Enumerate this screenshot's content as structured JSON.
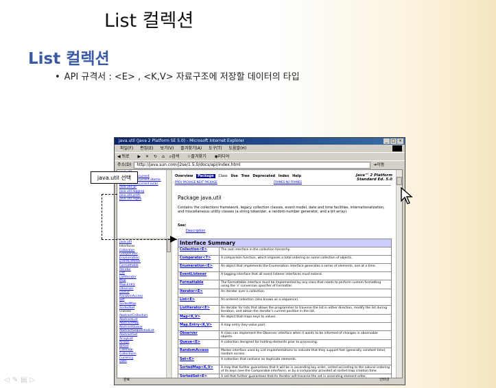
{
  "slide": {
    "title": "List 컬렉션",
    "heading": "List 컬렉션",
    "bullet": "API 규격서 : <E> , <K,V>  자료구조에 저장할 데이터의 타입"
  },
  "browser": {
    "window_title": "java.util (Java 2 Platform SE 5.0) - Microsoft Internet Explorer",
    "menu": [
      "파일(F)",
      "편집(E)",
      "보기(V)",
      "즐겨찾기(A)",
      "도구(T)",
      "도움말(H)"
    ],
    "toolbar": [
      "뒤로",
      "검색",
      "즐겨찾기",
      "미디어"
    ],
    "address_label": "주소(D)",
    "address_url": "http://java.sun.com/j2se/1.5.0/docs/api/index.html",
    "go_label": "이동",
    "status_left": "완료",
    "status_right": "인터넷"
  },
  "left_frame": {
    "packages": [
      "java.util",
      "java.util.concurrent",
      "java.util.concurrent.atomic",
      "java.util.concurrent.locks",
      "java.util.jar",
      "java.util.logging",
      "java.util.prefs",
      "java.util.regex"
    ],
    "current_package": "java.util",
    "interfaces_label": "Interfaces",
    "interfaces": [
      "Collection",
      "Comparator",
      "Enumeration",
      "EventListener",
      "Formattable",
      "Iterator",
      "List",
      "ListIterator",
      "Map",
      "Map.Entry",
      "Observer",
      "Queue",
      "RandomAccess",
      "Set",
      "SortedMap",
      "SortedSet"
    ],
    "classes_label": "Classes",
    "classes": [
      "AbstractCollection",
      "AbstractList",
      "AbstractMap",
      "AbstractQueue",
      "AbstractSequentialList",
      "AbstractSet",
      "ArrayList",
      "Arrays",
      "BitSet",
      "Calendar",
      "Collections",
      "Currency",
      "Date"
    ]
  },
  "doc": {
    "nav": [
      "Overview",
      "Package",
      "Class",
      "Use",
      "Tree",
      "Deprecated",
      "Index",
      "Help"
    ],
    "nav_active": "Package",
    "prev_next": "PREV PACKAGE   NEXT PACKAGE",
    "frames": "FRAMES   NO FRAMES",
    "platform_line1": "Java™ 2 Platform",
    "platform_line2": "Standard Ed. 5.0",
    "package_title": "Package java.util",
    "package_desc": "Contains the collections framework, legacy collection classes, event model, date and time facilities, internationalization, and miscellaneous utility classes (a string tokenizer, a random-number generator, and a bit array).",
    "see_label": "See:",
    "description_link": "Description",
    "table_title": "Interface Summary",
    "interfaces": [
      {
        "name": "Collection<E>",
        "desc": "The root interface in the collection hierarchy."
      },
      {
        "name": "Comparator<T>",
        "desc": "A comparison function, which imposes a total ordering on some collection of objects."
      },
      {
        "name": "Enumeration<E>",
        "desc": "An object that implements the Enumeration interface generates a series of elements, one at a time."
      },
      {
        "name": "EventListener",
        "desc": "A tagging interface that all event listener interfaces must extend."
      },
      {
        "name": "Formattable",
        "desc": "The Formattable interface must be implemented by any class that needs to perform custom formatting using the 's' conversion specifier of Formatter."
      },
      {
        "name": "Iterator<E>",
        "desc": "An iterator over a collection."
      },
      {
        "name": "List<E>",
        "desc": "An ordered collection (also known as a sequence)."
      },
      {
        "name": "ListIterator<E>",
        "desc": "An iterator for lists that allows the programmer to traverse the list in either direction, modify the list during iteration, and obtain the iterator's current position in the list."
      },
      {
        "name": "Map<K,V>",
        "desc": "An object that maps keys to values."
      },
      {
        "name": "Map.Entry<K,V>",
        "desc": "A map entry (key-value pair)."
      },
      {
        "name": "Observer",
        "desc": "A class can implement the Observer interface when it wants to be informed of changes in observable objects."
      },
      {
        "name": "Queue<E>",
        "desc": "A collection designed for holding elements prior to processing."
      },
      {
        "name": "RandomAccess",
        "desc": "Marker interface used by List implementations to indicate that they support fast (generally constant time) random access."
      },
      {
        "name": "Set<E>",
        "desc": "A collection that contains no duplicate elements."
      },
      {
        "name": "SortedMap<K,V>",
        "desc": "A map that further guarantees that it will be in ascending key order, sorted according to the natural ordering of its keys (see the Comparable interface), or by a comparator provided at sorted map creation time."
      },
      {
        "name": "SortedSet<E>",
        "desc": "A set that further guarantees that its iterator will traverse the set in ascending element order,"
      }
    ]
  },
  "callout": "java.util 선택"
}
